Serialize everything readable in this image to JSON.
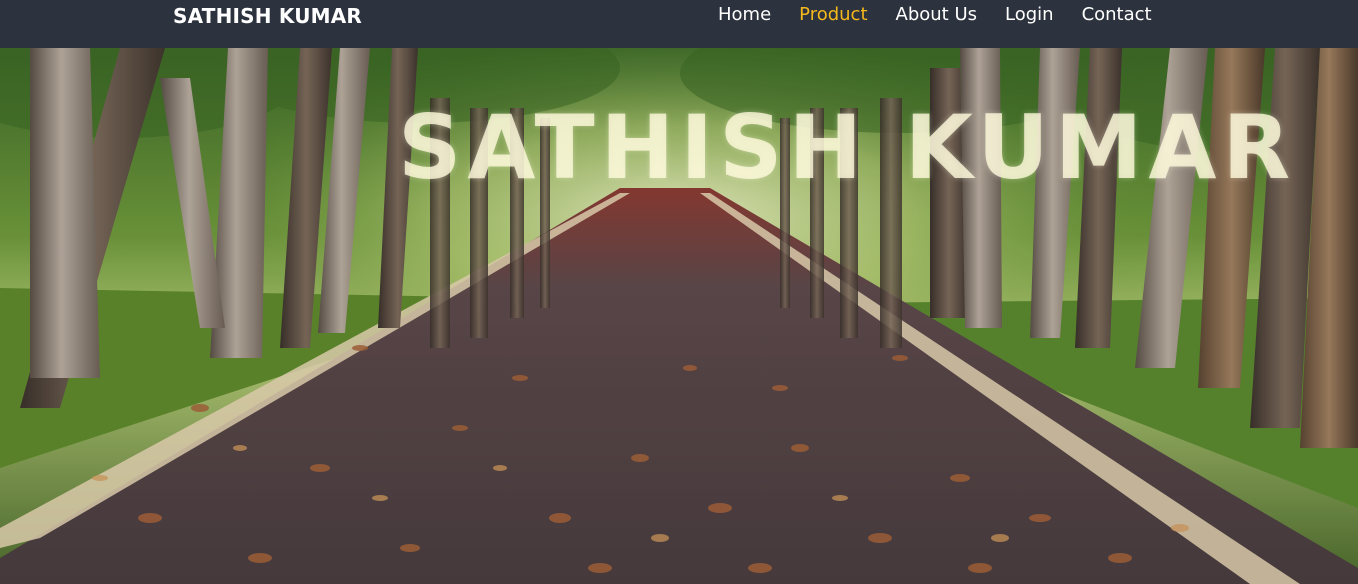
{
  "navbar": {
    "brand": "SATHISH KUMAR",
    "links": [
      {
        "label": "Home",
        "active": false
      },
      {
        "label": "Product",
        "active": true
      },
      {
        "label": "About Us",
        "active": false
      },
      {
        "label": "Login",
        "active": false
      },
      {
        "label": "Contact",
        "active": false
      }
    ],
    "bg_color": "#2d333e",
    "active_color": "#f5b81c"
  },
  "hero": {
    "title": "SATHISH KUMAR",
    "image_subject": "tree-lined road with fallen leaves"
  }
}
